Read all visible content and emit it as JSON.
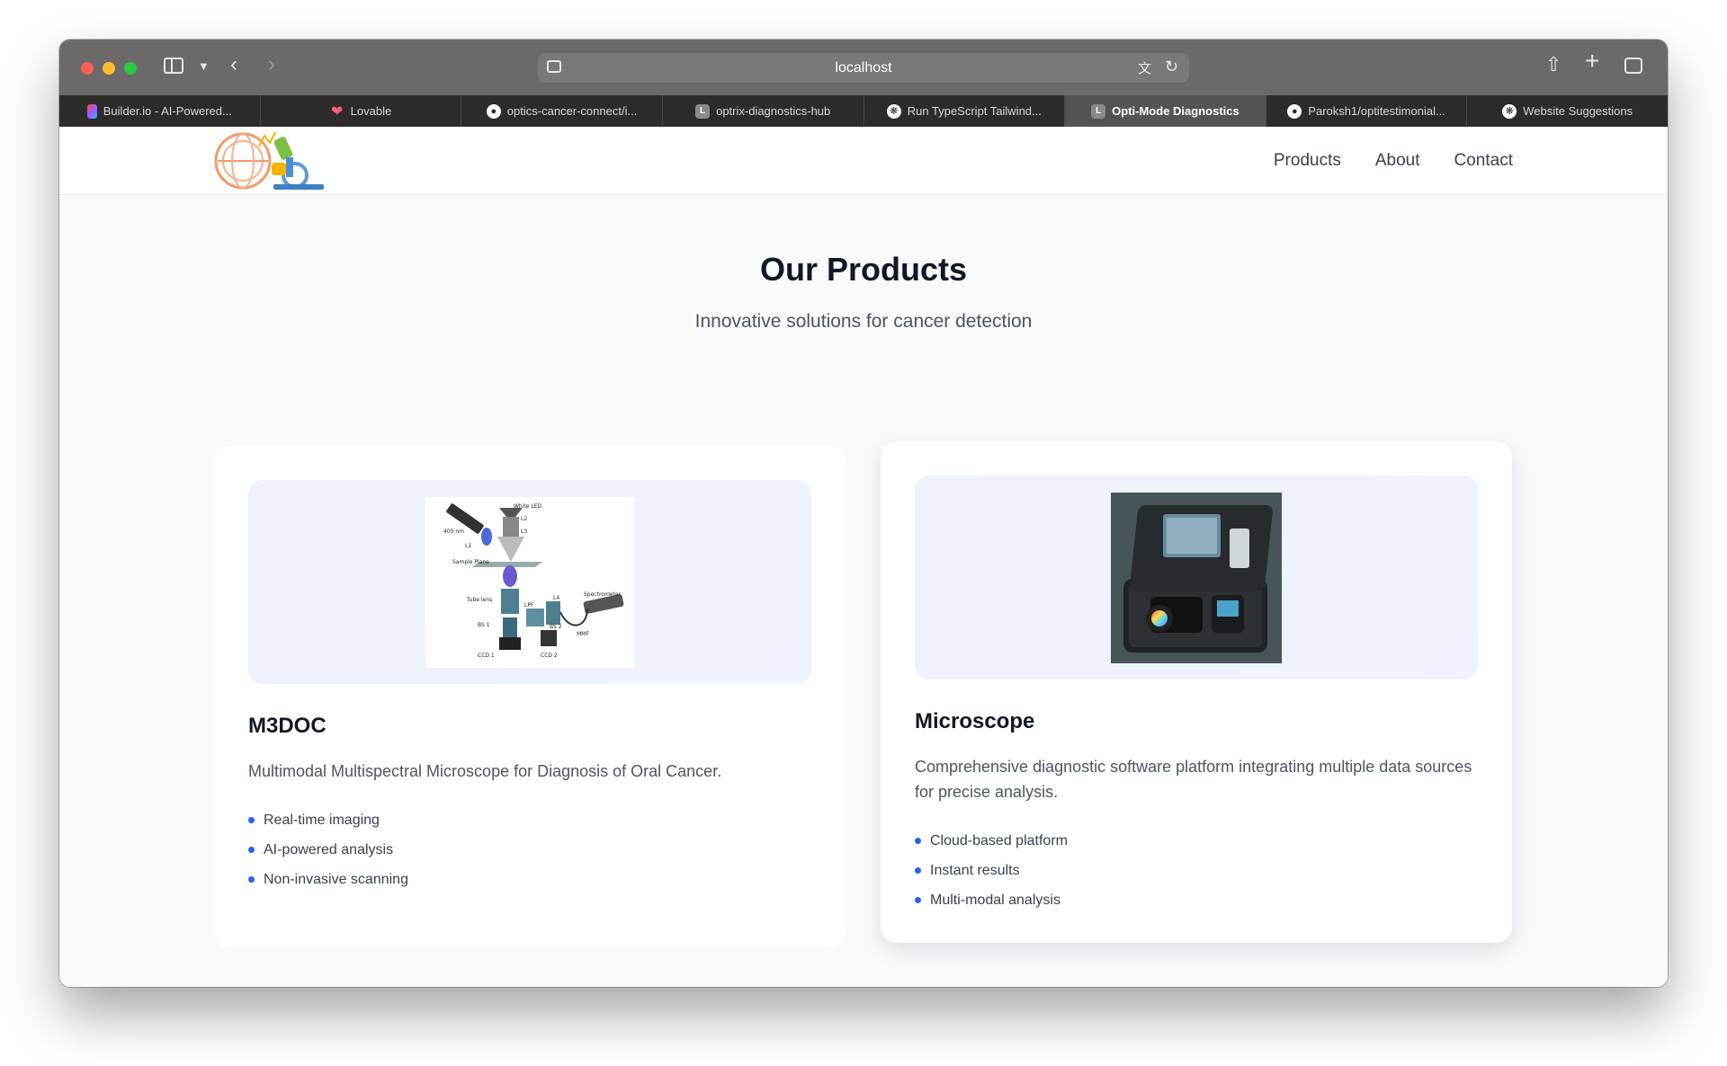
{
  "browser": {
    "url": "localhost",
    "tabs": [
      {
        "label": "Builder.io - AI-Powered...",
        "icon": "figma-icon",
        "active": false
      },
      {
        "label": "Lovable",
        "icon": "heart-icon",
        "active": false
      },
      {
        "label": "optics-cancer-connect/i...",
        "icon": "github-icon",
        "active": false
      },
      {
        "label": "optrix-diagnostics-hub",
        "icon": "lovable-l-icon",
        "active": false
      },
      {
        "label": "Run TypeScript Tailwind...",
        "icon": "openai-icon",
        "active": false
      },
      {
        "label": "Opti-Mode Diagnostics",
        "icon": "lovable-l-icon",
        "active": true
      },
      {
        "label": "Paroksh1/optitestimonial...",
        "icon": "github-icon",
        "active": false
      },
      {
        "label": "Website Suggestions",
        "icon": "openai-icon",
        "active": false
      }
    ]
  },
  "site": {
    "nav": [
      "Products",
      "About",
      "Contact"
    ]
  },
  "hero": {
    "title": "Our Products",
    "subtitle": "Innovative solutions for cancer detection"
  },
  "products": [
    {
      "title": "M3DOC",
      "description": "Multimodal Multispectral Microscope for Diagnosis of Oral Cancer.",
      "features": [
        "Real-time imaging",
        "AI-powered analysis",
        "Non-invasive scanning"
      ],
      "diagram_labels": [
        "White LED",
        "L2",
        "L3",
        "405 nm",
        "L1",
        "Sample Plane",
        "Tube lens",
        "LPF",
        "L4",
        "Spectrometer",
        "BS 1",
        "BS 2",
        "MMF",
        "CCD 1",
        "CCD 2"
      ]
    },
    {
      "title": "Microscope",
      "description": "Comprehensive diagnostic software platform integrating multiple data sources for precise analysis.",
      "features": [
        "Cloud-based platform",
        "Instant results",
        "Multi-modal analysis"
      ]
    }
  ],
  "colors": {
    "accent": "#2563eb",
    "page_bg": "#f8fafc",
    "toolbar": "#6b6a69",
    "tabbar": "#2d2c2b"
  }
}
